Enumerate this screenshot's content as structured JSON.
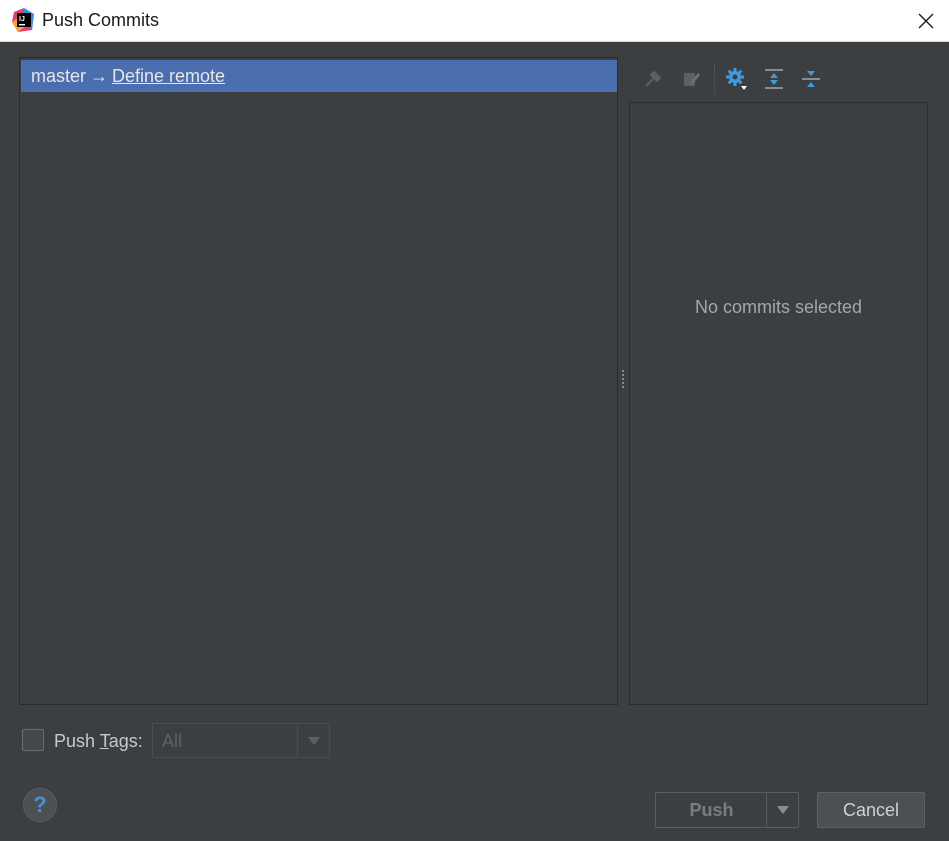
{
  "window": {
    "title": "Push Commits",
    "app_icon": "intellij-idea-icon",
    "close_icon": "close-icon"
  },
  "branches": {
    "local": "master",
    "arrow": "→",
    "remote_link": "Define remote"
  },
  "details": {
    "empty_text": "No commits selected",
    "toolbar": [
      {
        "name": "cherry-pick-icon",
        "enabled": false
      },
      {
        "name": "edit-source-icon",
        "enabled": false
      },
      {
        "name": "settings-gear-icon",
        "enabled": true
      },
      {
        "name": "expand-all-icon",
        "enabled": true
      },
      {
        "name": "collapse-all-icon",
        "enabled": true
      }
    ]
  },
  "options": {
    "push_tags_prefix": "Push ",
    "push_tags_mnemonic": "T",
    "push_tags_suffix": "ags:",
    "push_tags_checked": false,
    "tags_value": "All"
  },
  "footer": {
    "help_label": "?",
    "push_label": "Push",
    "cancel_label": "Cancel"
  },
  "colors": {
    "background": "#3c3f41",
    "selection": "#4b6eaf",
    "accent_blue": "#4c8fd6"
  }
}
